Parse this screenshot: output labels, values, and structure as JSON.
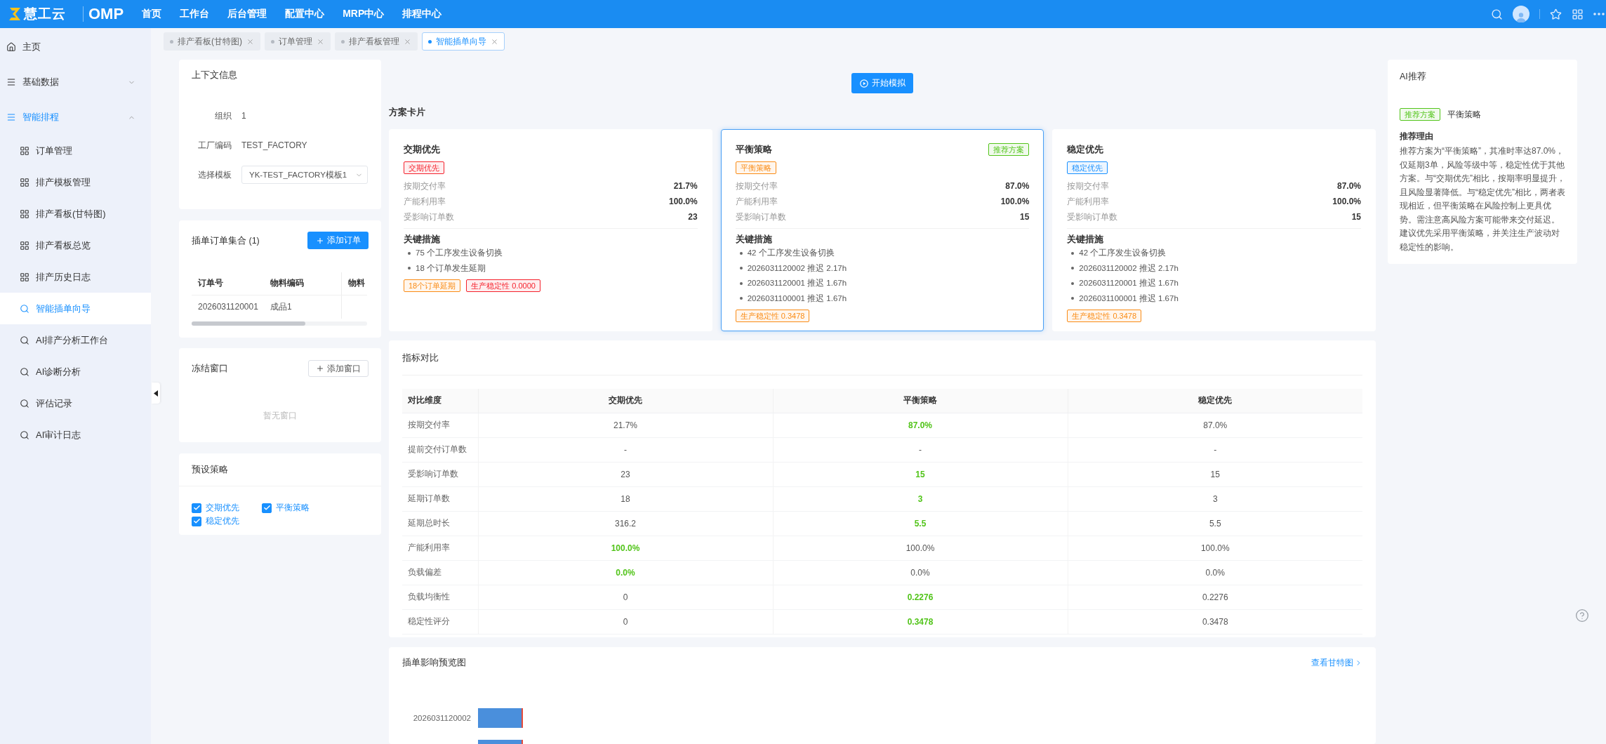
{
  "top_bar": {
    "logo": "慧工云",
    "product": "OMP",
    "nav": [
      "首页",
      "工作台",
      "后台管理",
      "配置中心",
      "MRP中心",
      "排程中心"
    ]
  },
  "tabs": [
    {
      "label": "排产看板(甘特图)",
      "selected": false
    },
    {
      "label": "订单管理",
      "selected": false
    },
    {
      "label": "排产看板管理",
      "selected": false
    },
    {
      "label": "智能插单向导",
      "selected": true
    }
  ],
  "sidebar": {
    "items": [
      {
        "kind": "home",
        "label": "主页",
        "selected": false
      },
      {
        "kind": "group",
        "label": "基础数据",
        "expanded": false,
        "selected": false
      },
      {
        "kind": "group",
        "label": "智能排程",
        "expanded": true,
        "selected": false,
        "children": [
          {
            "kind": "grid",
            "label": "订单管理",
            "selected": false
          },
          {
            "kind": "grid",
            "label": "排产模板管理",
            "selected": false
          },
          {
            "kind": "grid",
            "label": "排产看板(甘特图)",
            "selected": false
          },
          {
            "kind": "grid",
            "label": "排产看板总览",
            "selected": false
          },
          {
            "kind": "grid",
            "label": "排产历史日志",
            "selected": false
          },
          {
            "kind": "search",
            "label": "智能插单向导",
            "selected": true
          },
          {
            "kind": "search",
            "label": "AI排产分析工作台",
            "selected": false
          },
          {
            "kind": "search",
            "label": "AI诊断分析",
            "selected": false
          },
          {
            "kind": "search",
            "label": "评估记录",
            "selected": false
          },
          {
            "kind": "search",
            "label": "AI审计日志",
            "selected": false
          }
        ]
      }
    ]
  },
  "context_panel": {
    "title": "上下文信息",
    "fields": [
      {
        "kind": "text",
        "label": "组织",
        "value": "1"
      },
      {
        "kind": "text",
        "label": "工厂编码",
        "value": "TEST_FACTORY"
      },
      {
        "kind": "select",
        "label": "选择模板",
        "value": "YK-TEST_FACTORY模板1"
      }
    ]
  },
  "orders_panel": {
    "title": "插单订单集合 (1)",
    "add_button": "添加订单",
    "table": {
      "columns": [
        "订单号",
        "物料编码",
        "物料"
      ],
      "rows": [
        [
          "2026031120001",
          "成品1"
        ]
      ]
    }
  },
  "windows_panel": {
    "title": "冻结窗口",
    "add_button": "添加窗口",
    "empty_text": "暂无窗口"
  },
  "strategies_panel": {
    "title": "预设策略",
    "options": [
      {
        "label": "交期优先",
        "checked": true
      },
      {
        "label": "平衡策略",
        "checked": true
      },
      {
        "label": "稳定优先",
        "checked": true
      }
    ]
  },
  "simulate_button": "开始模拟",
  "scheme_cards": {
    "title": "方案卡片",
    "cards": [
      {
        "title": "交期优先",
        "selected": false,
        "tag": {
          "text": "交期优先",
          "color": "#f5222d"
        },
        "metrics": [
          {
            "label": "按期交付率",
            "value": "21.7%"
          },
          {
            "label": "产能利用率",
            "value": "100.0%"
          },
          {
            "label": "受影响订单数",
            "value": "23"
          }
        ],
        "measures_title": "关键措施",
        "measures": [
          "75 个工序发生设备切换",
          "18 个订单发生延期"
        ],
        "footer_tags": [
          {
            "text": "18个订单延期",
            "color": "#fa8c16"
          },
          {
            "text": "生产稳定性 0.0000",
            "color": "#f5222d"
          }
        ]
      },
      {
        "title": "平衡策略",
        "selected": true,
        "badge": "推荐方案",
        "tag": {
          "text": "平衡策略",
          "color": "#fa8c16"
        },
        "metrics": [
          {
            "label": "按期交付率",
            "value": "87.0%"
          },
          {
            "label": "产能利用率",
            "value": "100.0%"
          },
          {
            "label": "受影响订单数",
            "value": "15"
          }
        ],
        "measures_title": "关键措施",
        "measures": [
          "42 个工序发生设备切换",
          "2026031120002 推迟 2.17h",
          "2026031120001 推迟 1.67h",
          "2026031100001 推迟 1.67h"
        ],
        "footer_tags": [
          {
            "text": "生产稳定性 0.3478",
            "color": "#fa8c16"
          }
        ]
      },
      {
        "title": "稳定优先",
        "selected": false,
        "tag": {
          "text": "稳定优先",
          "color": "#1890ff"
        },
        "metrics": [
          {
            "label": "按期交付率",
            "value": "87.0%"
          },
          {
            "label": "产能利用率",
            "value": "100.0%"
          },
          {
            "label": "受影响订单数",
            "value": "15"
          }
        ],
        "measures_title": "关键措施",
        "measures": [
          "42 个工序发生设备切换",
          "2026031120002 推迟 2.17h",
          "2026031120001 推迟 1.67h",
          "2026031100001 推迟 1.67h"
        ],
        "footer_tags": [
          {
            "text": "生产稳定性 0.3478",
            "color": "#fa8c16"
          }
        ]
      }
    ]
  },
  "ai_panel": {
    "title": "AI推荐",
    "badge": "推荐方案",
    "choice": "平衡策略",
    "reason_title": "推荐理由",
    "reason": "推荐方案为“平衡策略”，其准时率达87.0%，仅延期3单，风险等级中等，稳定性优于其他方案。与“交期优先”相比，按期率明显提升，且风险显著降低。与“稳定优先”相比，两者表现相近，但平衡策略在风险控制上更具优势。需注意高风险方案可能带来交付延迟。建议优先采用平衡策略，并关注生产波动对稳定性的影响。"
  },
  "comparison": {
    "title": "指标对比",
    "dimension_header": "对比维度",
    "columns": [
      "交期优先",
      "平衡策略",
      "稳定优先"
    ],
    "rows": [
      {
        "label": "按期交付率",
        "cells": [
          {
            "value": "21.7%",
            "best": false
          },
          {
            "value": "87.0%",
            "best": true
          },
          {
            "value": "87.0%",
            "best": false
          }
        ]
      },
      {
        "label": "提前交付订单数",
        "cells": [
          {
            "value": "-",
            "best": false
          },
          {
            "value": "-",
            "best": false
          },
          {
            "value": "-",
            "best": false
          }
        ]
      },
      {
        "label": "受影响订单数",
        "cells": [
          {
            "value": "23",
            "best": false
          },
          {
            "value": "15",
            "best": true
          },
          {
            "value": "15",
            "best": false
          }
        ]
      },
      {
        "label": "延期订单数",
        "cells": [
          {
            "value": "18",
            "best": false
          },
          {
            "value": "3",
            "best": true
          },
          {
            "value": "3",
            "best": false
          }
        ]
      },
      {
        "label": "延期总时长",
        "cells": [
          {
            "value": "316.2",
            "best": false
          },
          {
            "value": "5.5",
            "best": true
          },
          {
            "value": "5.5",
            "best": false
          }
        ]
      },
      {
        "label": "产能利用率",
        "cells": [
          {
            "value": "100.0%",
            "best": true
          },
          {
            "value": "100.0%",
            "best": false
          },
          {
            "value": "100.0%",
            "best": false
          }
        ]
      },
      {
        "label": "负载偏差",
        "cells": [
          {
            "value": "0.0%",
            "best": true
          },
          {
            "value": "0.0%",
            "best": false
          },
          {
            "value": "0.0%",
            "best": false
          }
        ]
      },
      {
        "label": "负载均衡性",
        "cells": [
          {
            "value": "0",
            "best": false
          },
          {
            "value": "0.2276",
            "best": true
          },
          {
            "value": "0.2276",
            "best": false
          }
        ]
      },
      {
        "label": "稳定性评分",
        "cells": [
          {
            "value": "0",
            "best": false
          },
          {
            "value": "0.3478",
            "best": true
          },
          {
            "value": "0.3478",
            "best": false
          }
        ]
      }
    ]
  },
  "preview": {
    "title": "插单影响预览图",
    "link": "查看甘特图",
    "bars": [
      {
        "kind": "full",
        "label": "2026031120002"
      },
      {
        "kind": "clipped"
      }
    ]
  }
}
